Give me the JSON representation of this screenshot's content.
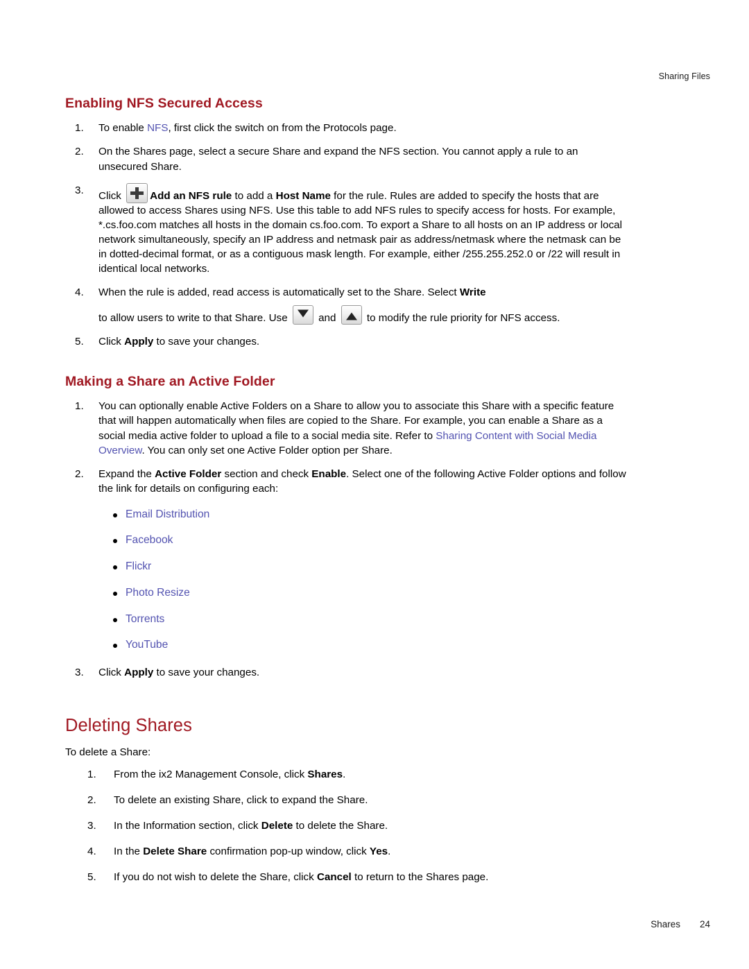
{
  "header": {
    "running_head": "Sharing Files"
  },
  "footer": {
    "section_label": "Shares",
    "page_number": "24"
  },
  "colors": {
    "heading_red": "#A01822",
    "link_blue": "#5252B0",
    "body_text": "#000000"
  },
  "sections": [
    {
      "id": "enabling-nfs-secured-access",
      "heading": "Enabling NFS Secured Access",
      "heading_level": "h2",
      "steps": [
        {
          "num": "1.",
          "pre": "To enable ",
          "link": "NFS",
          "post": ", first click the switch on from the Protocols page."
        },
        {
          "num": "2.",
          "text": "On the Shares page, select a secure Share and expand the NFS section. You cannot apply a rule to an unsecured Share."
        },
        {
          "num": "3.",
          "t1": "Click ",
          "icon": "plus-icon",
          "b1": "Add an NFS rule",
          "t2": " to add a ",
          "b2": "Host Name",
          "t3": " for the rule. Rules are added to specify the hosts that are allowed to access Shares using NFS. Use this table to add NFS rules to specify access for hosts. For example, *.cs.foo.com matches all hosts in the domain cs.foo.com. To export a Share to all hosts on an IP address or local network simultaneously, specify an IP address and netmask pair as address/netmask where the netmask can be in dotted-decimal format, or as a contiguous mask length. For example, either /255.255.252.0 or /22 will result in identical local networks."
        },
        {
          "num": "4.",
          "t1": "When the rule is added, read access is automatically set to the Share. Select ",
          "b1": "Write",
          "t2": " to allow users to write to that Share. Use ",
          "icon_down": "arrow-down-icon",
          "t3": " and ",
          "icon_up": "arrow-up-icon",
          "t4": " to modify the rule priority for NFS access."
        },
        {
          "num": "5.",
          "t1": "Click ",
          "b1": "Apply",
          "t2": " to save your changes."
        }
      ]
    },
    {
      "id": "making-a-share-an-active-folder",
      "heading": "Making a Share an Active Folder",
      "heading_level": "h2",
      "steps": [
        {
          "num": "1.",
          "t1": "You can optionally enable Active Folders on a Share to allow you to associate this Share with a specific feature that will happen automatically when files are copied to the Share. For example, you can enable a Share as a social media active folder to upload a file to a social media site. Refer to ",
          "link": "Sharing Content with Social Media Overview",
          "t2": ". You can only set one Active Folder option per Share."
        },
        {
          "num": "2.",
          "t1": "Expand the ",
          "b1": "Active Folder",
          "t2": " section and check ",
          "b2": "Enable",
          "t3": ". Select one of the following Active Folder options and follow the link for details on configuring each:",
          "bullets": [
            "Email Distribution",
            "Facebook",
            "Flickr",
            "Photo Resize",
            "Torrents",
            "YouTube"
          ]
        },
        {
          "num": "3.",
          "t1": "Click ",
          "b1": "Apply",
          "t2": " to save your changes."
        }
      ]
    },
    {
      "id": "deleting-shares",
      "heading": "Deleting Shares",
      "heading_level": "h1",
      "intro": "To delete a Share:",
      "steps": [
        {
          "num": "1.",
          "t1": "From the ix2 Management Console, click ",
          "b1": "Shares",
          "t2": "."
        },
        {
          "num": "2.",
          "t1": "To delete an existing Share, click to expand the Share."
        },
        {
          "num": "3.",
          "t1": "In the Information section, click ",
          "b1": "Delete",
          "t2": " to delete the Share."
        },
        {
          "num": "4.",
          "t1": "In the ",
          "b1": "Delete Share",
          "t2": " confirmation pop-up window, click ",
          "b2": "Yes",
          "t3": "."
        },
        {
          "num": "5.",
          "t1": "If you do not wish to delete the Share, click ",
          "b1": "Cancel",
          "t2": " to return to the Shares page."
        }
      ]
    }
  ]
}
